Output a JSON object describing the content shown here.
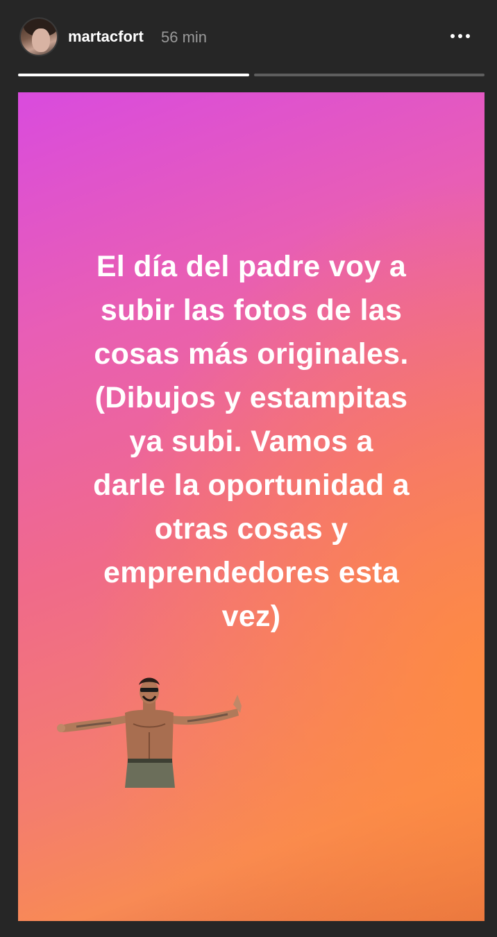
{
  "header": {
    "username": "martacfort",
    "time": "56 min",
    "more_icon": "more-horizontal-icon"
  },
  "progress": {
    "segments": [
      {
        "state": "viewed",
        "fill": 1
      },
      {
        "state": "unviewed",
        "fill": 0
      }
    ],
    "colors": {
      "active": "#ffffff",
      "inactive": "#5e5e5e"
    }
  },
  "story": {
    "text": "El día del padre voy a\nsubir las fotos de las\ncosas más originales.\n(Dibujos y estampitas\nya subi. Vamos a\ndarle la oportunidad a\notras cosas y\nemprendedores esta\nvez)",
    "gradient": [
      "#d94bde",
      "#f06a8a",
      "#f88a55",
      "#dd6a3f"
    ],
    "sticker": "shirtless-man-sticker"
  },
  "colors": {
    "background": "#262626",
    "text": "#ffffff",
    "muted": "#9a9a9a"
  }
}
